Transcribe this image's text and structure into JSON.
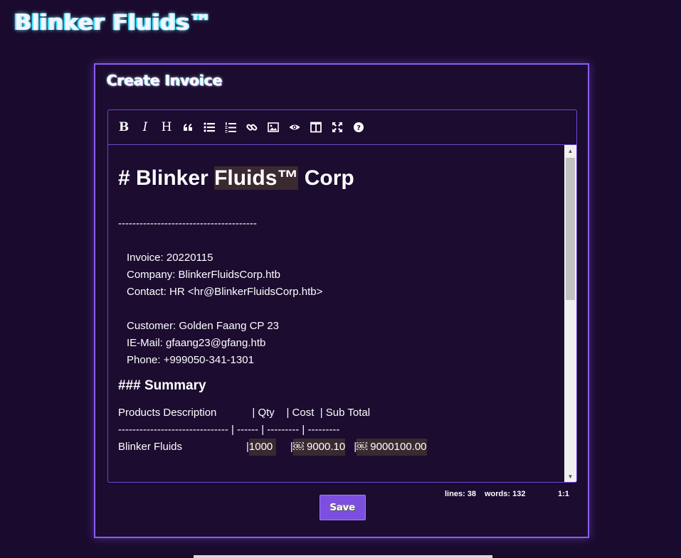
{
  "brand": "Blinker Fluids™",
  "card": {
    "title": "Create Invoice"
  },
  "toolbar": {
    "bold": "B",
    "italic": "I",
    "heading": "H",
    "quote": "❝",
    "icons": [
      "bold-icon",
      "italic-icon",
      "heading-icon",
      "quote-icon",
      "unordered-list-icon",
      "ordered-list-icon",
      "link-icon",
      "image-icon",
      "preview-icon",
      "side-by-side-icon",
      "fullscreen-icon",
      "help-icon"
    ]
  },
  "editor": {
    "h1_prefix": "# Blinker ",
    "h1_highlight": "Fluids™",
    "h1_suffix": " Corp",
    "rule": "---------------------------------------",
    "invoice": "Invoice: 20220115",
    "company": "Company: BlinkerFluidsCorp.htb",
    "contact": "Contact: HR <hr@BlinkerFluidsCorp.htb>",
    "customer": "Customer: Golden Faang CP 23",
    "email": "IE-Mail: gfaang23@gfang.htb",
    "phone": "Phone: +999050-341-1301",
    "summary": "### Summary",
    "table_header": "Products Description            | Qty    | Cost  | Sub Total",
    "table_rule": "------------------------------- | ------ | --------- | ---------",
    "row_product": "Blinker Fluids",
    "row_sep1": "| ",
    "row_qty": "1000",
    "row_sep2": "| ",
    "row_cost": "￼ 9000.10",
    "row_sep3": "| ",
    "row_subtotal": "￼ 9000100.00"
  },
  "status": {
    "lines": "lines: 38",
    "words": "words: 132",
    "cursor": "1:1"
  },
  "save_label": "Save",
  "colors": {
    "background": "#1a0b2e",
    "accent": "#8a5cf0",
    "button": "#7d4fe0"
  }
}
